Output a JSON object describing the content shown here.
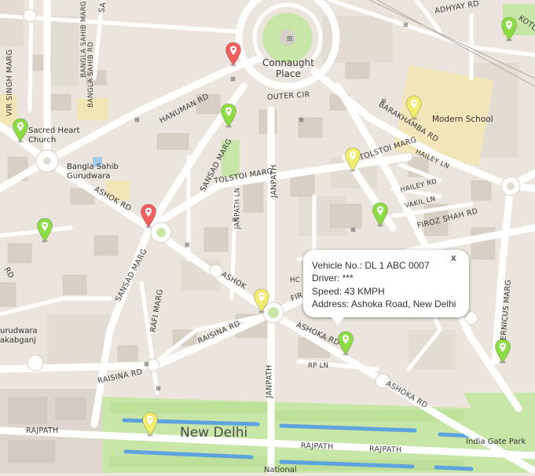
{
  "map": {
    "place_labels": {
      "connaught_place": "Connaught\nPlace",
      "modern_school": "Modern School",
      "sacred_heart_church": "Sacred Heart\nChurch",
      "bangla_sahib_gurudwara": "Bangla Sahib\nGurudwara",
      "new_delhi": "New Delhi",
      "india_gate_park": "India Gate Park",
      "gurudwara_rakabganj": "urudwara\nakabganj",
      "national": "National"
    },
    "road_labels": {
      "outer_cir": "OUTER CIR",
      "hanuman_rd": "HANUMAN RD",
      "ashok_rd": "ASHOK RD",
      "sansad_marg_1": "SANSAD MARG",
      "sansad_marg_2": "SANSAD MARG",
      "tolstoi_marg_1": "TOLSTOI MARG",
      "tolstoi_marg_2": "TOLSTOI MARG",
      "janpath_1": "JANPATH",
      "janpath_2": "JANPATH",
      "janpath_ln": "JANPATH LN",
      "barakhamba_rd": "BARAKHAMBA RD",
      "hailey_ln": "HAILEY LN",
      "hailey_rd": "HAILEY RD",
      "vakil_ln": "VAKIL LN",
      "firoz_shah_rd": "FIROZ SHAH RD",
      "ashoka_rd_1": "ASHOKA RD",
      "ashoka_rd_2": "ASHOKA RD",
      "ashoka_rd_3": "ASHOKA RD",
      "raisina_rd_1": "RAISINA RD",
      "raisina_rd_2": "RAISINA RD",
      "rafi_marg": "RAFI MARG",
      "rp_ln": "RP LN",
      "rajpath_1": "RAJPATH",
      "rajpath_2": "RAJPATH",
      "rajpath_3": "RAJPATH",
      "bangla_sahib_marg": "BANGLA SAHIB MARG",
      "bangla_sahib_rd": "BANGLA SAHIB RD",
      "vir_singh_marg": "VIR SINGH MARG",
      "kotla": "KOTLA",
      "adhyay_rd": "ADHYAY RD",
      "copernicus_marg": "OPERNICUS MARG",
      "fir": "FIR",
      "hc": "HC",
      "ashok_partial": "ASHOK",
      "left_rd": "RD",
      "top_sa": "SA"
    },
    "marker_colors": {
      "green": "#8ddc45",
      "yellow": "#f1ec6e",
      "red": "#f25d5d"
    },
    "markers": [
      {
        "id": "marker-red-connaught",
        "status": "red"
      },
      {
        "id": "marker-red-ashok-rd",
        "status": "red"
      },
      {
        "id": "marker-green-kotla",
        "status": "green"
      },
      {
        "id": "marker-green-sacred-heart",
        "status": "green"
      },
      {
        "id": "marker-green-hanuman-rd",
        "status": "green"
      },
      {
        "id": "marker-green-left",
        "status": "green"
      },
      {
        "id": "marker-green-firoz-shah",
        "status": "green"
      },
      {
        "id": "marker-green-ashoka-rd",
        "status": "green"
      },
      {
        "id": "marker-green-copernicus",
        "status": "green"
      },
      {
        "id": "marker-yellow-barakhamba",
        "status": "yellow"
      },
      {
        "id": "marker-yellow-tolstoi",
        "status": "yellow"
      },
      {
        "id": "marker-yellow-janpath",
        "status": "yellow"
      },
      {
        "id": "marker-yellow-rajpath",
        "status": "yellow"
      }
    ]
  },
  "popup": {
    "vehicle_no": "Vehicle No.: DL 1 ABC 0007",
    "driver": "Driver: ***",
    "speed": "Speed: 43 KMPH",
    "address": "Address: Ashoka Road, New Delhi",
    "close": "x"
  }
}
